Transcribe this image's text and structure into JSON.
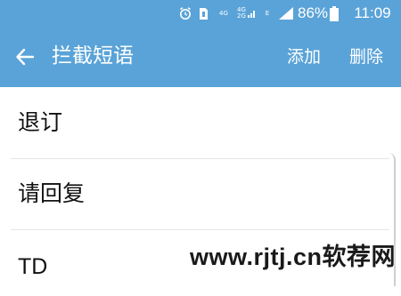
{
  "status_bar": {
    "net_4g": "4G",
    "net_dual_top": "4G",
    "net_dual_bottom": "2G",
    "net_e": "E",
    "battery_percent": "86%",
    "time": "11:09",
    "icons": [
      "alarm-icon",
      "sim-icon",
      "signal-icon",
      "battery-icon"
    ]
  },
  "app_bar": {
    "title": "拦截短语",
    "back_icon": "arrow-left-icon",
    "actions": {
      "add": "添加",
      "delete": "删除"
    }
  },
  "list": {
    "items": [
      {
        "label": "退订"
      },
      {
        "label": "请回复"
      },
      {
        "label": "TD"
      }
    ]
  },
  "watermark": "www.rjtj.cn软荐网",
  "colors": {
    "header_bg": "#5aa3d8",
    "text": "#111111",
    "divider": "#e6e6e6"
  }
}
